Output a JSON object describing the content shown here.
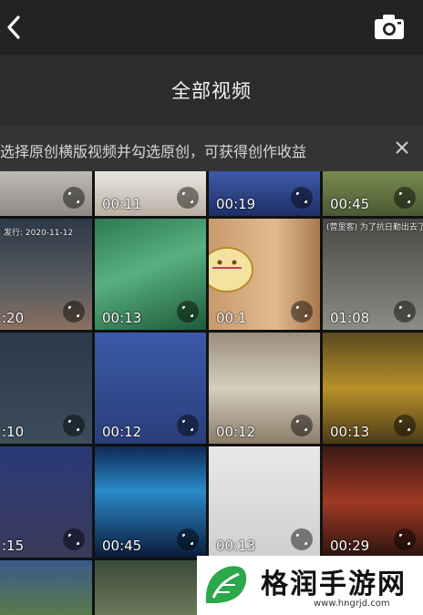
{
  "header": {
    "back_icon": "chevron-left-icon",
    "camera_icon": "camera-icon",
    "title": "全部视频"
  },
  "notice": {
    "text": "选择原创横版视频并勾选原创，可获得创作收益",
    "close_icon": "close-icon"
  },
  "videos": [
    {
      "duration": "",
      "caption": ""
    },
    {
      "duration": "00:11",
      "caption": ""
    },
    {
      "duration": "00:19",
      "caption": ""
    },
    {
      "duration": "00:45",
      "caption": ""
    },
    {
      "duration": ":20",
      "caption": "发行: 2020-11-12"
    },
    {
      "duration": "00:13",
      "caption": ""
    },
    {
      "duration": "00:1",
      "caption": ""
    },
    {
      "duration": "01:08",
      "caption": "(营里客) 为了抗日勤出去了"
    },
    {
      "duration": ":10",
      "caption": ""
    },
    {
      "duration": "00:12",
      "caption": ""
    },
    {
      "duration": "00:12",
      "caption": ""
    },
    {
      "duration": "00:13",
      "caption": ""
    },
    {
      "duration": ":15",
      "caption": ""
    },
    {
      "duration": "00:45",
      "caption": ""
    },
    {
      "duration": "00:13",
      "caption": ""
    },
    {
      "duration": "00:29",
      "caption": ""
    }
  ],
  "watermark": {
    "name": "格润手游网",
    "url": "www.hngrjd.com"
  },
  "colors": {
    "topbar": "#232323",
    "titlebar": "#2c2c2c",
    "notice": "#343434"
  }
}
